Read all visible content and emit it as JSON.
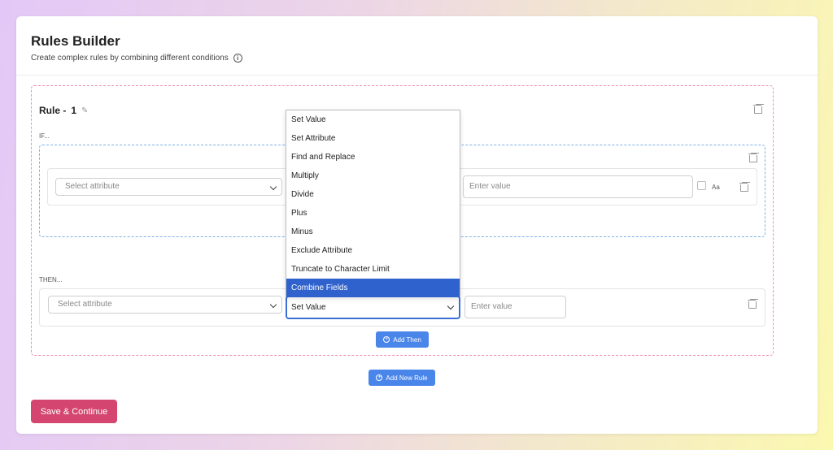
{
  "header": {
    "title": "Rules Builder",
    "subtitle": "Create complex rules by combining different conditions",
    "info_icon": "i"
  },
  "rule": {
    "title_prefix": "Rule -",
    "number": "1",
    "edit_icon": "✎",
    "if_label": "IF...",
    "then_label": "THEN...",
    "condition": {
      "attribute_placeholder": "Select attribute",
      "value_placeholder": "Enter value",
      "case_label": "Aa"
    },
    "action": {
      "attribute_placeholder": "Select attribute",
      "operation_selected": "Set Value",
      "value_placeholder": "Enter value"
    },
    "add_then_label": "Add Then"
  },
  "add_new_rule_label": "Add New Rule",
  "save_label": "Save & Continue",
  "dropdown": {
    "options": [
      "Set Value",
      "Set Attribute",
      "Find and Replace",
      "Multiply",
      "Divide",
      "Plus",
      "Minus",
      "Exclude Attribute",
      "Truncate to Character Limit",
      "Combine Fields"
    ],
    "highlighted": "Combine Fields"
  },
  "colors": {
    "rule_border": "#ef8fae",
    "if_border": "#7fb0e6",
    "primary_blue": "#4a86ea",
    "save_button": "#d4466f",
    "menu_highlight": "#2f62cc"
  }
}
